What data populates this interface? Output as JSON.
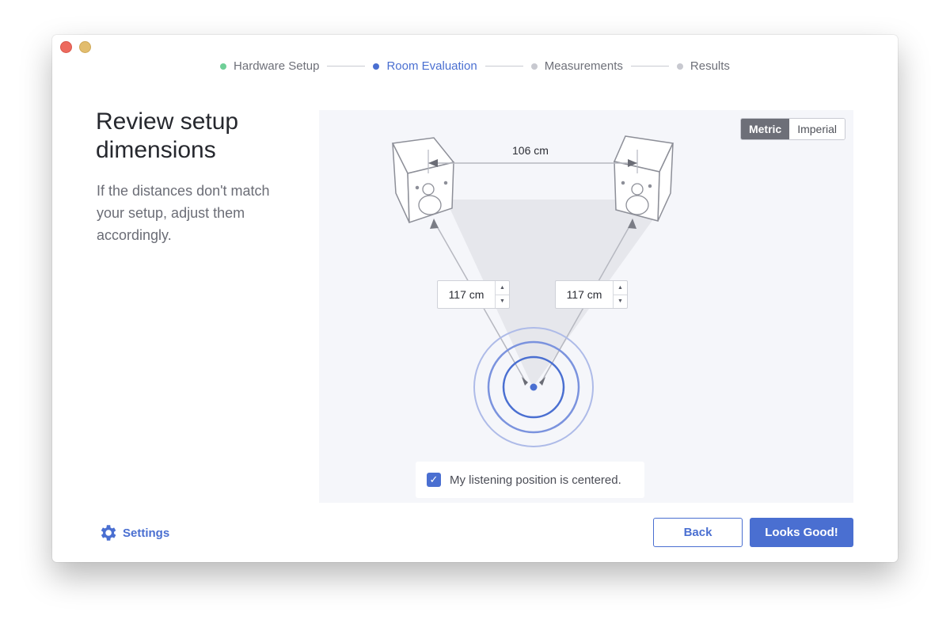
{
  "steps": [
    {
      "label": "Hardware Setup",
      "state": "done"
    },
    {
      "label": "Room Evaluation",
      "state": "active"
    },
    {
      "label": "Measurements",
      "state": "pending"
    },
    {
      "label": "Results",
      "state": "pending"
    }
  ],
  "heading": "Review setup dimensions",
  "description": "If the distances don't match your setup, adjust them accordingly.",
  "units": {
    "metric": "Metric",
    "imperial": "Imperial",
    "selected": "Metric"
  },
  "diagram": {
    "speaker_spacing": "106 cm",
    "left_distance": "117 cm",
    "right_distance": "117 cm"
  },
  "centered_checkbox": {
    "label": "My listening position is centered.",
    "checked": true
  },
  "footer": {
    "settings": "Settings",
    "back": "Back",
    "confirm": "Looks Good!"
  },
  "colors": {
    "accent": "#4a6fd1",
    "done": "#6fcf97",
    "pending": "#c8c9d0"
  }
}
